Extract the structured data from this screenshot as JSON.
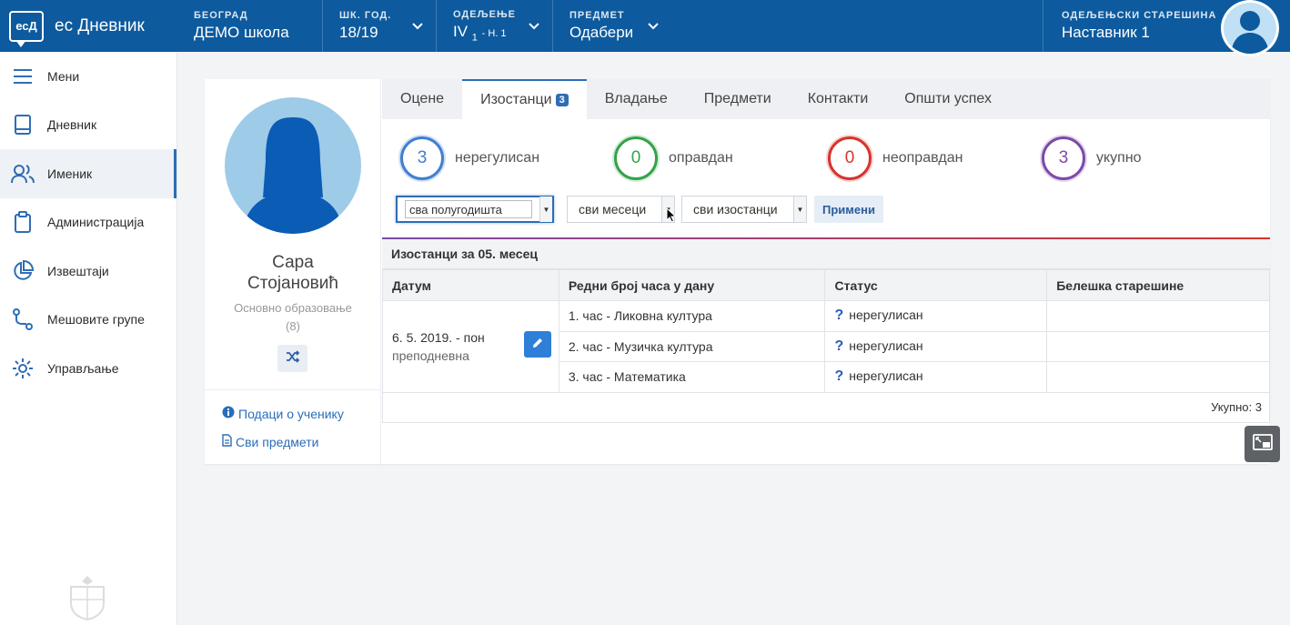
{
  "header": {
    "brand_logo": "есД",
    "brand_name": "ес Дневник",
    "city_label": "БЕОГРАД",
    "city_value": "ДЕМО школа",
    "year_label": "ШК. ГОД.",
    "year_value": "18/19",
    "dept_label": "ОДЕЉЕЊЕ",
    "dept_value": "IV",
    "dept_sub": "1",
    "dept_suffix": "- Н. 1",
    "subject_label": "ПРЕДМЕТ",
    "subject_value": "Одабери",
    "teacher_label": "ОДЕЉЕЊСКИ СТАРЕШИНА",
    "teacher_value": "Наставник 1"
  },
  "sidebar": {
    "items": [
      {
        "label": "Мени",
        "icon": "menu-icon"
      },
      {
        "label": "Дневник",
        "icon": "book-icon"
      },
      {
        "label": "Именик",
        "icon": "users-icon"
      },
      {
        "label": "Администрација",
        "icon": "clipboard-icon"
      },
      {
        "label": "Извештаји",
        "icon": "pie-chart-icon"
      },
      {
        "label": "Мешовите групе",
        "icon": "route-icon"
      },
      {
        "label": "Управљање",
        "icon": "gear-icon"
      }
    ],
    "active_index": 2
  },
  "profile": {
    "first_name": "Сара",
    "last_name": "Стојановић",
    "education": "Основно образовање",
    "grade": "(8)",
    "link_info": "Подаци о ученику",
    "link_subjects": "Сви предмети"
  },
  "tabs": [
    {
      "label": "Оцене"
    },
    {
      "label": "Изостанци",
      "badge": "3"
    },
    {
      "label": "Владање"
    },
    {
      "label": "Предмети"
    },
    {
      "label": "Контакти"
    },
    {
      "label": "Општи успех"
    }
  ],
  "stats": [
    {
      "value": "3",
      "label": "нерегулисан",
      "color": "#3f7fd0"
    },
    {
      "value": "0",
      "label": "оправдан",
      "color": "#35a24a"
    },
    {
      "value": "0",
      "label": "неоправдан",
      "color": "#d7332d"
    },
    {
      "value": "3",
      "label": "укупно",
      "color": "#7b4aa8"
    }
  ],
  "filters": {
    "semester": "сва полугодишта",
    "month": "сви месеци",
    "absences": "сви изостанци",
    "apply": "Примени"
  },
  "table": {
    "caption": "Изостанци за 05. месец",
    "headers": [
      "Датум",
      "Редни број часа у дану",
      "Статус",
      "Белешка старешине"
    ],
    "date": "6. 5. 2019. - пон",
    "shift": "преподневна",
    "rows": [
      {
        "lesson": "1. час - Ликовна култура",
        "status": "нерегулисан",
        "note": ""
      },
      {
        "lesson": "2. час - Музичка култура",
        "status": "нерегулисан",
        "note": ""
      },
      {
        "lesson": "3. час - Математика",
        "status": "нерегулисан",
        "note": ""
      }
    ],
    "total": "Укупно: 3"
  }
}
